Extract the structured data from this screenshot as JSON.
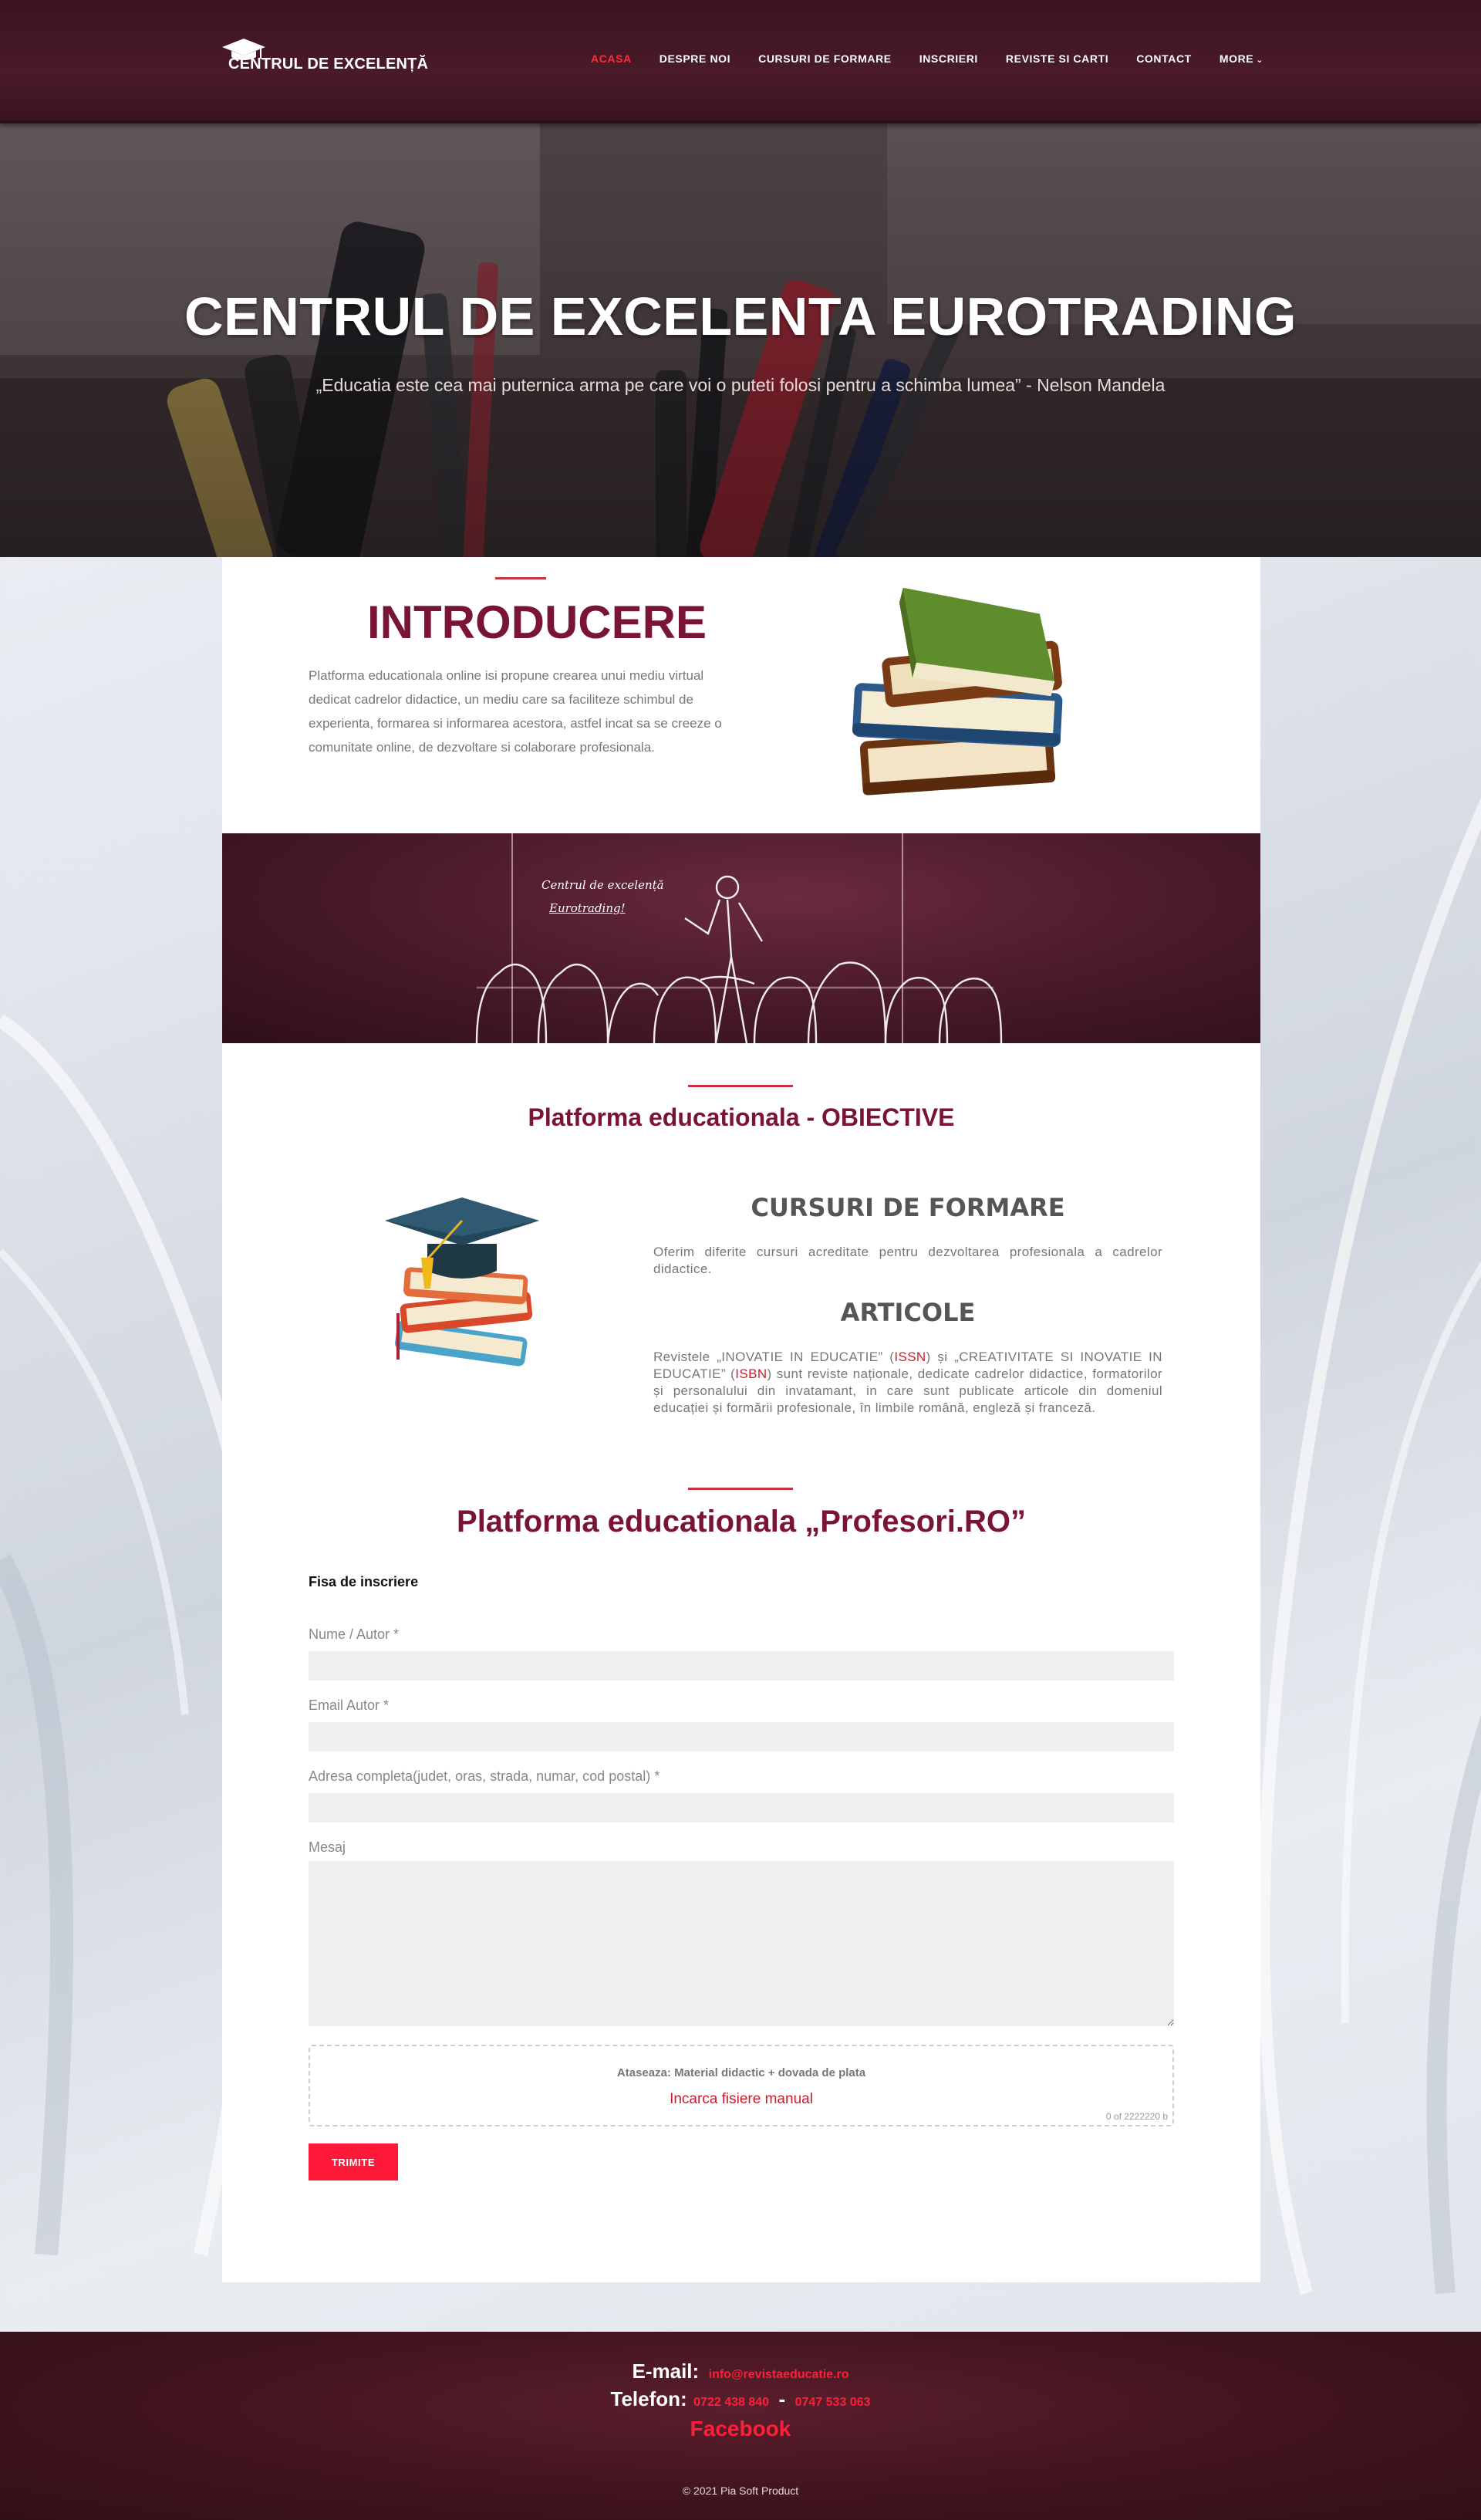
{
  "header": {
    "logo_text": "CENTRUL DE EXCELENȚĂ",
    "nav": [
      {
        "label": "ACASA",
        "active": true
      },
      {
        "label": "DESPRE NOI"
      },
      {
        "label": "CURSURI DE FORMARE"
      },
      {
        "label": "INSCRIERI"
      },
      {
        "label": "REVISTE SI CARTI"
      },
      {
        "label": "CONTACT"
      },
      {
        "label": "MORE"
      }
    ]
  },
  "hero": {
    "title": "CENTRUL DE EXCELENTA EUROTRADING",
    "quote": "„Educatia este cea mai puternica arma pe care voi o puteti folosi pentru a schimba lumea” - Nelson Mandela"
  },
  "intro": {
    "title": "INTRODUCERE",
    "text": "Platforma educationala online isi propune crearea unui mediu virtual dedicat cadrelor didactice, un mediu care sa faciliteze schimbul de experienta, formarea si informarea acestora, astfel incat sa se creeze o comunitate online, de dezvoltare si colaborare profesionala."
  },
  "banner": {
    "line1": "Centrul de excelență",
    "line2": "Eurotrading!"
  },
  "objectives": {
    "title": "Platforma educationala - OBIECTIVE",
    "courses_title": "CURSURI DE FORMARE",
    "courses_text": "Oferim diferite cursuri acreditate pentru dezvoltarea profesionala a cadrelor didactice.",
    "articles_title": "ARTICOLE",
    "articles_text_1": "Revistele „INOVATIE IN EDUCATIE” (",
    "issn": "ISSN",
    "articles_text_2": ") și „CREATIVITATE SI INOVATIE IN EDUCATIE” (",
    "isbn": "ISBN",
    "articles_text_3": ") sunt reviste naționale, dedicate cadrelor didactice, formatorilor și personalului din invatamant, in care sunt publicate articole din domeniul educației și formării profesionale, în limbile română, engleză și franceză."
  },
  "form": {
    "section_title": "Platforma educationala „Profesori.RO”",
    "fisa": "Fisa de inscriere",
    "name_label": "Nume / Autor *",
    "email_label": "Email Autor *",
    "address_label": "Adresa completa(judet, oras, strada, numar, cod postal) *",
    "message_label": "Mesaj",
    "upload_title": "Ataseaza: Material didactic + dovada de plata",
    "upload_link": "Incarca fisiere manual",
    "upload_count": "0 of 2222220 b",
    "submit": "TRIMITE"
  },
  "footer": {
    "email_key": "E-mail:",
    "email": "info@revistaeducatie.ro",
    "phone_key": "Telefon:",
    "phone1": "0722 438 840",
    "phone_sep": "-",
    "phone2": "0747 533 063",
    "facebook": "Facebook",
    "copyright": "© 2021 Pia Soft Product"
  },
  "colors": {
    "header_bg": "#3b1420",
    "accent_red": "#ff1a3a",
    "title_maroon": "#7a1436"
  }
}
